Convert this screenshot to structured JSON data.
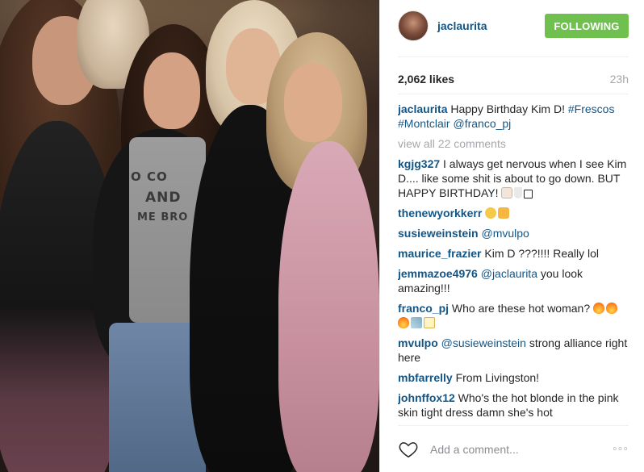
{
  "header": {
    "username": "jaclaurita",
    "follow_label": "FOLLOWING"
  },
  "meta": {
    "likes": "2,062 likes",
    "time_ago": "23h"
  },
  "caption": {
    "user": "jaclaurita",
    "text": "Happy Birthday Kim D!",
    "tags": [
      "#Frescos",
      "#Montclair",
      "@franco_pj"
    ]
  },
  "view_all": "view all 22 comments",
  "comments": [
    {
      "user": "kgjg327",
      "text": "I always get nervous when I see Kim D.... like some shit is about to go down. BUT HAPPY BIRTHDAY!"
    },
    {
      "user": "thenewyorkkerr",
      "text": ""
    },
    {
      "user": "susieweinstein",
      "mention": "@mvulpo",
      "text": ""
    },
    {
      "user": "maurice_frazier",
      "text": "Kim D ???!!!! Really lol"
    },
    {
      "user": "jemmazoe4976",
      "mention": "@jaclaurita",
      "text": "you look amazing!!!"
    },
    {
      "user": "franco_pj",
      "text": "Who are these hot woman?"
    },
    {
      "user": "mvulpo",
      "mention": "@susieweinstein",
      "text": "strong alliance right here"
    },
    {
      "user": "mbfarrelly",
      "text": "From Livingston!"
    },
    {
      "user": "johnffox12",
      "text": "Who's the hot blonde in the pink skin tight dress damn she's hot"
    }
  ],
  "footer": {
    "add_comment_placeholder": "Add a comment...",
    "more_label": "◦◦◦"
  },
  "photo": {
    "shirt_lines": [
      "O CO",
      "AND",
      "ME BRO"
    ]
  },
  "icons": {
    "heart": "heart-icon",
    "more": "more-options-icon",
    "avatar": "avatar"
  },
  "colors": {
    "link_blue": "#125688",
    "follow_green": "#70c050",
    "muted": "#a5a7aa"
  }
}
